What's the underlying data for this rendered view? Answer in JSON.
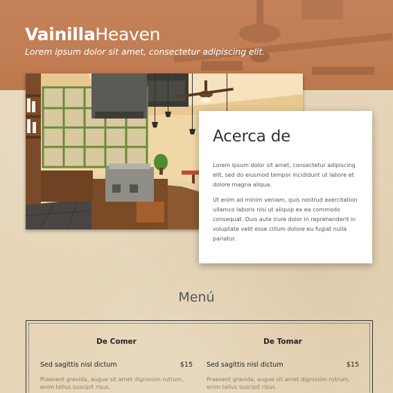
{
  "header": {
    "brand_bold": "Vainilla",
    "brand_regular": "Heaven",
    "tagline": "Lorem ipsum dolor sit amet, consectetur adipiscing elit."
  },
  "hero": {
    "image": "cafe-interior-photo"
  },
  "about": {
    "title": "Acerca de",
    "paragraphs": [
      "Lorem ipsum dolor sit amet, consectetur adipiscing elit, sed do eiusmod tempor incididunt ut labore et dolore magna aliqua.",
      "Ut enim ad minim veniam, quis nostrud exercitation ullamco laboris nisi ut aliquip ex ea commodo consequat. Duis aute irure dolor in reprehenderit in voluptate velit esse cillum dolore eu fugiat nulla pariatur."
    ]
  },
  "menu": {
    "title": "Menú",
    "columns": [
      {
        "heading": "De Comer",
        "items": [
          {
            "name": "Sed sagittis nisl dictum",
            "price": "$15",
            "description": "Praesent gravida, augue sit amet dignissim rutrum, enim tellus suscipit risus."
          }
        ]
      },
      {
        "heading": "De Tomar",
        "items": [
          {
            "name": "Sed sagittis nisl dictum",
            "price": "$15",
            "description": "Praesent gravida, augue sit amet dignissim rutrum, enim tellus suscipit risus."
          }
        ]
      }
    ]
  },
  "colors": {
    "header_band": "#c17d53",
    "page_background": "#e6d5b8",
    "card": "#ffffff",
    "text_dark": "#333333"
  }
}
